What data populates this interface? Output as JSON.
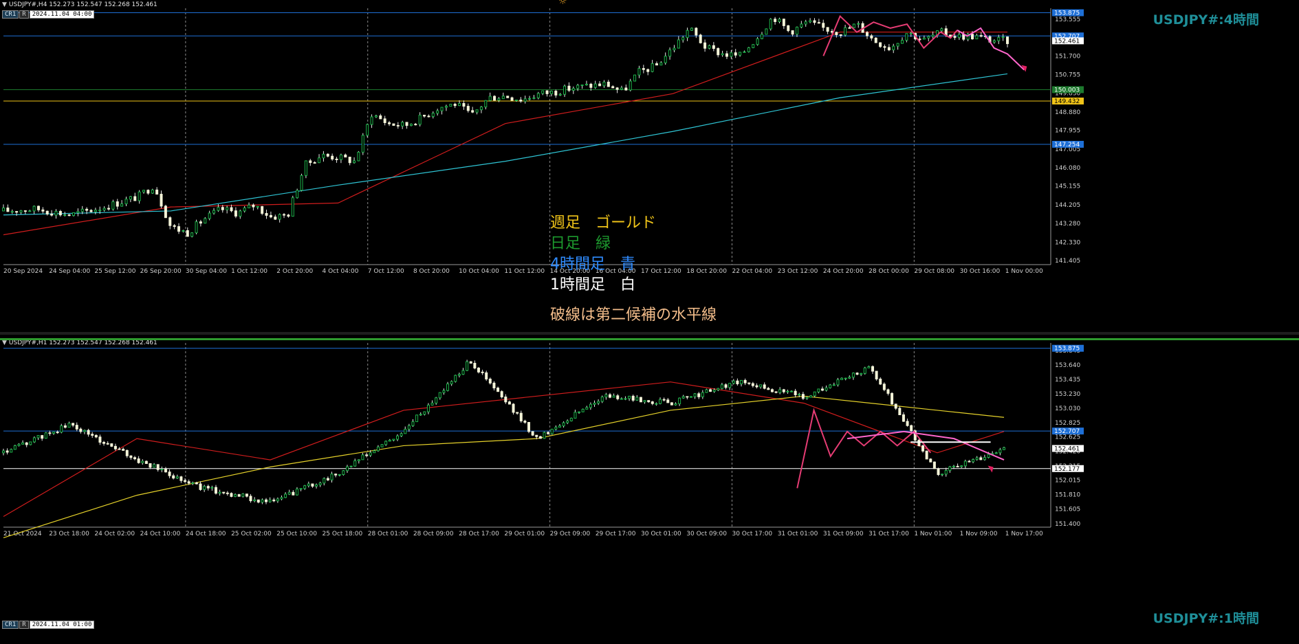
{
  "top": {
    "header": "USDJPY#,H4  152.273 152.547 152.268 152.461",
    "tf_label": "USDJPY#:4時間",
    "cr_labels": [
      "CR1",
      "R"
    ],
    "cr_date": "2024.11.04 04:00",
    "y_ticks": [
      "153.555",
      "152.635",
      "151.700",
      "150.755",
      "149.830",
      "148.880",
      "147.955",
      "147.005",
      "146.080",
      "145.155",
      "144.205",
      "143.280",
      "142.330",
      "141.405"
    ],
    "price_tags": [
      {
        "value": "153.875",
        "color": "#1e6fd6"
      },
      {
        "value": "152.707",
        "color": "#1e6fd6"
      },
      {
        "value": "152.461",
        "color": "#ffffff"
      },
      {
        "value": "150.003",
        "color": "#1d7a2e"
      },
      {
        "value": "149.432",
        "color": "#f0c419"
      },
      {
        "value": "147.254",
        "color": "#1e6fd6"
      }
    ],
    "x_ticks": [
      "20 Sep 2024",
      "24 Sep 04:00",
      "25 Sep 12:00",
      "26 Sep 20:00",
      "30 Sep 04:00",
      "1 Oct 12:00",
      "2 Oct 20:00",
      "4 Oct 04:00",
      "7 Oct 12:00",
      "8 Oct 20:00",
      "10 Oct 04:00",
      "11 Oct 12:00",
      "14 Oct 20:00",
      "16 Oct 04:00",
      "17 Oct 12:00",
      "18 Oct 20:00",
      "22 Oct 04:00",
      "23 Oct 12:00",
      "24 Oct 20:00",
      "28 Oct 00:00",
      "29 Oct 08:00",
      "30 Oct 16:00",
      "1 Nov 00:00"
    ]
  },
  "bottom": {
    "header": "USDJPY#,H1  152.273 152.547 152.268 152.461",
    "tf_label": "USDJPY#:1時間",
    "cr_labels": [
      "CR1",
      "R"
    ],
    "cr_date": "2024.11.04 01:00",
    "y_ticks": [
      "153.845",
      "153.640",
      "153.435",
      "153.230",
      "153.030",
      "152.825",
      "152.625",
      "152.420",
      "152.215",
      "152.015",
      "151.810",
      "151.605",
      "151.400"
    ],
    "price_tags": [
      {
        "value": "153.875",
        "color": "#1e6fd6"
      },
      {
        "value": "152.707",
        "color": "#1e6fd6"
      },
      {
        "value": "152.461",
        "color": "#ffffff"
      },
      {
        "value": "152.177",
        "color": "#ffffff"
      }
    ],
    "x_ticks": [
      "21 Oct 2024",
      "23 Oct 18:00",
      "24 Oct 02:00",
      "24 Oct 10:00",
      "24 Oct 18:00",
      "25 Oct 02:00",
      "25 Oct 10:00",
      "25 Oct 18:00",
      "28 Oct 01:00",
      "28 Oct 09:00",
      "28 Oct 17:00",
      "29 Oct 01:00",
      "29 Oct 09:00",
      "29 Oct 17:00",
      "30 Oct 01:00",
      "30 Oct 09:00",
      "30 Oct 17:00",
      "31 Oct 01:00",
      "31 Oct 09:00",
      "31 Oct 17:00",
      "1 Nov 01:00",
      "1 Nov 09:00",
      "1 Nov 17:00"
    ]
  },
  "legend": [
    {
      "text": "週足　ゴールド",
      "color": "#f0c419"
    },
    {
      "text": "日足　緑",
      "color": "#1d9a2e"
    },
    {
      "text": "4時間足　青",
      "color": "#2f8cff"
    },
    {
      "text": "1時間足　白",
      "color": "#ffffff"
    }
  ],
  "note": "破線は第二候補の水平線",
  "chart_data": [
    {
      "type": "line",
      "title": "USDJPY#:4時間",
      "ylim": [
        141.2,
        154.1
      ],
      "series": [
        {
          "name": "price",
          "x": [
            0,
            10,
            20,
            30,
            40,
            45,
            50,
            55,
            60,
            65,
            70,
            75,
            80,
            85,
            90,
            95,
            100,
            105,
            110,
            115,
            120,
            125,
            130,
            135,
            140,
            145,
            150,
            155,
            160,
            165,
            170,
            175,
            180,
            185,
            190,
            195,
            200,
            205,
            210,
            215,
            220,
            225,
            230,
            235,
            240,
            245,
            250,
            255,
            260,
            265,
            270,
            275,
            280,
            285,
            290,
            295,
            300
          ],
          "values": [
            143.9,
            144.0,
            143.7,
            144.1,
            144.6,
            145.2,
            143.1,
            142.8,
            143.5,
            144.0,
            143.8,
            144.2,
            143.6,
            143.7,
            146.2,
            146.7,
            146.6,
            146.4,
            148.8,
            148.3,
            148.2,
            148.6,
            149.1,
            149.3,
            148.7,
            149.6,
            149.7,
            149.5,
            149.8,
            149.9,
            150.1,
            150.2,
            150.3,
            149.9,
            150.9,
            151.2,
            152.1,
            153.1,
            152.1,
            151.8,
            151.7,
            152.6,
            153.7,
            152.9,
            153.4,
            153.1,
            152.9,
            153.3,
            152.5,
            152.1,
            152.9,
            152.5,
            152.9,
            152.7,
            152.7,
            152.5,
            152.461
          ]
        },
        {
          "name": "MA red",
          "x": [
            0,
            50,
            100,
            150,
            200,
            250,
            300
          ],
          "values": [
            142.7,
            144.1,
            144.3,
            148.3,
            149.8,
            152.9,
            152.9
          ]
        },
        {
          "name": "MA cyan",
          "x": [
            0,
            50,
            100,
            150,
            200,
            250,
            300
          ],
          "values": [
            143.7,
            143.9,
            145.2,
            146.4,
            147.9,
            149.6,
            150.8
          ]
        }
      ],
      "levels": [
        153.875,
        152.707,
        150.003,
        149.432,
        147.254
      ]
    },
    {
      "type": "line",
      "title": "USDJPY#:1時間",
      "ylim": [
        151.35,
        153.95
      ],
      "series": [
        {
          "name": "price",
          "x": [
            0,
            20,
            40,
            60,
            80,
            100,
            120,
            140,
            160,
            180,
            200,
            220,
            240,
            260,
            280,
            300
          ],
          "values": [
            152.4,
            152.8,
            152.3,
            151.9,
            151.7,
            152.1,
            152.7,
            153.7,
            152.6,
            153.2,
            153.1,
            153.4,
            153.2,
            153.6,
            152.1,
            152.461
          ]
        },
        {
          "name": "MA red",
          "x": [
            0,
            40,
            80,
            120,
            160,
            200,
            240,
            280,
            300
          ],
          "values": [
            151.5,
            152.6,
            152.3,
            153.0,
            153.2,
            153.4,
            153.1,
            152.4,
            152.7
          ]
        },
        {
          "name": "MA yellow",
          "x": [
            0,
            40,
            80,
            120,
            160,
            200,
            240,
            280,
            300
          ],
          "values": [
            151.2,
            151.8,
            152.2,
            152.5,
            152.6,
            153.0,
            153.2,
            153.0,
            152.9
          ]
        }
      ],
      "levels": [
        153.875,
        152.707,
        152.177
      ]
    }
  ]
}
